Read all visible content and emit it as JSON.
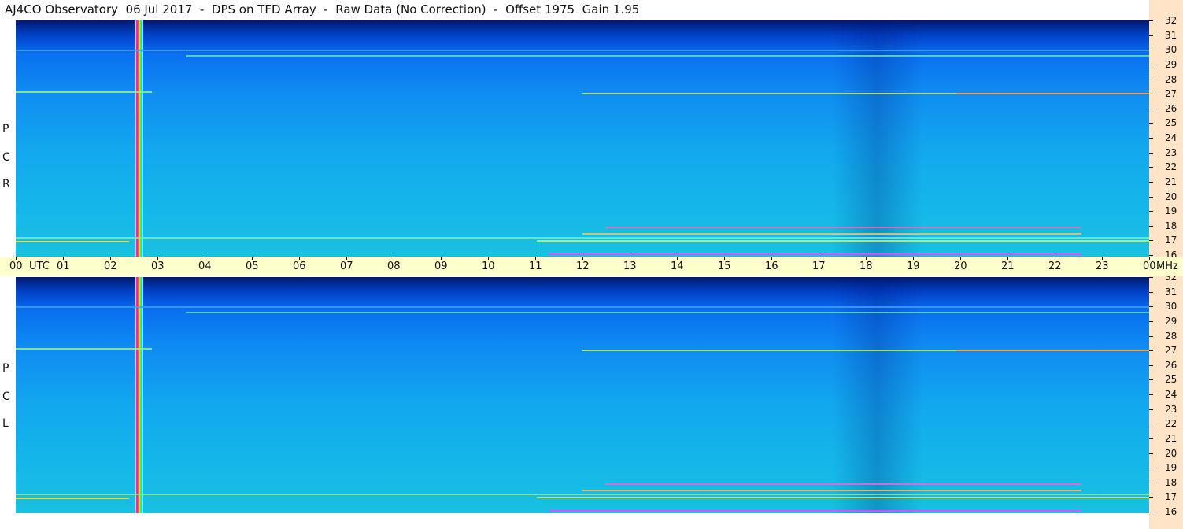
{
  "header": {
    "title": "AJ4CO Observatory  06 Jul 2017  -  DPS on TFD Array  -  Raw Data (No Correction)  -  Offset 1975  Gain 1.95"
  },
  "panels": [
    {
      "id": "rcp",
      "label_letters": [
        "R",
        "C",
        "P"
      ]
    },
    {
      "id": "lcp",
      "label_letters": [
        "L",
        "C",
        "P"
      ]
    }
  ],
  "freq_axis": {
    "unit": "MHz",
    "labels": [
      "32",
      "31",
      "30",
      "29",
      "28",
      "27",
      "26",
      "25",
      "24",
      "23",
      "22",
      "21",
      "20",
      "19",
      "18",
      "17",
      "16"
    ]
  },
  "time_axis": {
    "labels": [
      "00",
      "UTC",
      "01",
      "02",
      "03",
      "04",
      "05",
      "06",
      "07",
      "08",
      "09",
      "10",
      "11",
      "12",
      "13",
      "14",
      "15",
      "16",
      "17",
      "18",
      "19",
      "20",
      "21",
      "22",
      "23",
      "00",
      "MHz"
    ]
  },
  "colors": {
    "freq_axis_bg": "#ffe4c8",
    "time_axis_bg": "#ffffcc"
  }
}
